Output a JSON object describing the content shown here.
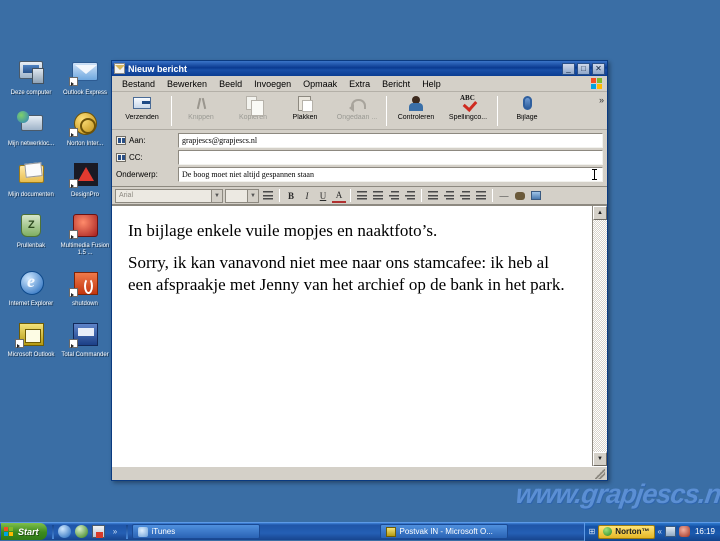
{
  "desktop": {
    "icons": [
      {
        "label": "Deze computer",
        "icon": "my-computer-icon",
        "shortcut": false
      },
      {
        "label": "Outlook Express",
        "icon": "outlook-express-icon",
        "shortcut": true
      },
      {
        "label": "Mijn netwerkloc...",
        "icon": "network-places-icon",
        "shortcut": false
      },
      {
        "label": "Norton Inter...",
        "icon": "norton-internet-security-icon",
        "shortcut": true
      },
      {
        "label": "Mijn documenten",
        "icon": "my-documents-icon",
        "shortcut": false
      },
      {
        "label": "DesignPro",
        "icon": "designpro-icon",
        "shortcut": true
      },
      {
        "label": "Prullenbak",
        "icon": "recycle-bin-icon",
        "shortcut": false
      },
      {
        "label": "Multimedia Fusion 1.5 ...",
        "icon": "multimedia-fusion-icon",
        "shortcut": true
      },
      {
        "label": "Internet Explorer",
        "icon": "internet-explorer-icon",
        "shortcut": false
      },
      {
        "label": "shutdown",
        "icon": "shutdown-icon",
        "shortcut": true
      },
      {
        "label": "Microsoft Outlook",
        "icon": "microsoft-outlook-icon",
        "shortcut": true
      },
      {
        "label": "Total Commander",
        "icon": "total-commander-icon",
        "shortcut": true
      }
    ],
    "watermark": "www.grapjescs.nl"
  },
  "window": {
    "title": "Nieuw bericht",
    "title_icon": "envelope-icon",
    "buttons": {
      "minimize": "_",
      "maximize": "□",
      "close": "✕"
    },
    "menu": [
      "Bestand",
      "Bewerken",
      "Beeld",
      "Invoegen",
      "Opmaak",
      "Extra",
      "Bericht",
      "Help"
    ],
    "menu_logo": "windows-flag-icon",
    "toolbar": {
      "overflow": "»",
      "items": [
        {
          "label": "Verzenden",
          "icon": "send-icon",
          "enabled": true
        },
        {
          "label": "Knippen",
          "icon": "cut-icon",
          "enabled": false
        },
        {
          "label": "Kopiëren",
          "icon": "copy-icon",
          "enabled": false
        },
        {
          "label": "Plakken",
          "icon": "paste-icon",
          "enabled": false
        },
        {
          "label": "Ongedaan ...",
          "icon": "undo-icon",
          "enabled": false
        },
        {
          "label": "Controleren",
          "icon": "check-names-icon",
          "enabled": true
        },
        {
          "label": "Spellingco...",
          "icon": "spellcheck-icon",
          "enabled": true
        },
        {
          "label": "Bijlage",
          "icon": "paperclip-icon",
          "enabled": true
        }
      ]
    },
    "headers": {
      "to_label": "Aan:",
      "to_value": "grapjescs@grapjescs.nl",
      "cc_label": "CC:",
      "cc_value": "",
      "subject_label": "Onderwerp:",
      "subject_value": "De boog moet niet altijd gespannen staan",
      "address_book_icon": "address-book-icon"
    },
    "format_bar": {
      "font_name": "Arial",
      "font_size": "",
      "dropdown_arrow": "▼",
      "buttons": [
        {
          "name": "paragraph-style-button",
          "glyph": "≡"
        },
        {
          "name": "bold-button",
          "glyph": "B"
        },
        {
          "name": "italic-button",
          "glyph": "I"
        },
        {
          "name": "underline-button",
          "glyph": "U"
        },
        {
          "name": "font-color-button",
          "glyph": "A"
        },
        {
          "name": "numbered-list-button",
          "glyph": "list"
        },
        {
          "name": "bulleted-list-button",
          "glyph": "list"
        },
        {
          "name": "decrease-indent-button",
          "glyph": "list"
        },
        {
          "name": "increase-indent-button",
          "glyph": "list"
        },
        {
          "name": "align-left-button",
          "glyph": "lines"
        },
        {
          "name": "align-center-button",
          "glyph": "lines"
        },
        {
          "name": "align-right-button",
          "glyph": "lines"
        },
        {
          "name": "justify-button",
          "glyph": "lines"
        },
        {
          "name": "horizontal-rule-button",
          "glyph": "—"
        },
        {
          "name": "insert-link-button",
          "glyph": "link"
        },
        {
          "name": "insert-picture-button",
          "glyph": "picture"
        }
      ]
    },
    "body_paragraphs": [
      "In bijlage enkele vuile mopjes en naaktfoto’s.",
      "Sorry, ik kan vanavond niet mee naar ons stamcafee: ik heb al een afspraakje met Jenny van het archief op de bank in het park."
    ],
    "scrollbar": {
      "up_arrow": "▲",
      "down_arrow": "▼"
    },
    "status_text": ""
  },
  "taskbar": {
    "start_label": "Start",
    "quick_launch": [
      {
        "name": "quick-launch-ie-icon"
      },
      {
        "name": "quick-launch-browser-icon"
      },
      {
        "name": "quick-launch-save-icon"
      },
      {
        "name": "quick-launch-more-icon",
        "glyph": "»"
      }
    ],
    "tasks": [
      {
        "label": "iTunes",
        "icon": "itunes-icon"
      },
      {
        "label": "Postvak IN - Microsoft O...",
        "icon": "outlook-icon"
      }
    ],
    "tray": {
      "norton_label": "Norton™",
      "chevron": "«",
      "icons": [
        "network-icon",
        "antivirus-icon"
      ],
      "clock": "16:19"
    }
  },
  "colors": {
    "desktop_blue": "#3a6ea5",
    "titlebar_blue": "#0a3a91",
    "window_face": "#d4d0c8",
    "taskbar_blue": "#1f55a8",
    "start_green": "#3c8a1e",
    "watermark_blue": "#5b8fd4"
  }
}
